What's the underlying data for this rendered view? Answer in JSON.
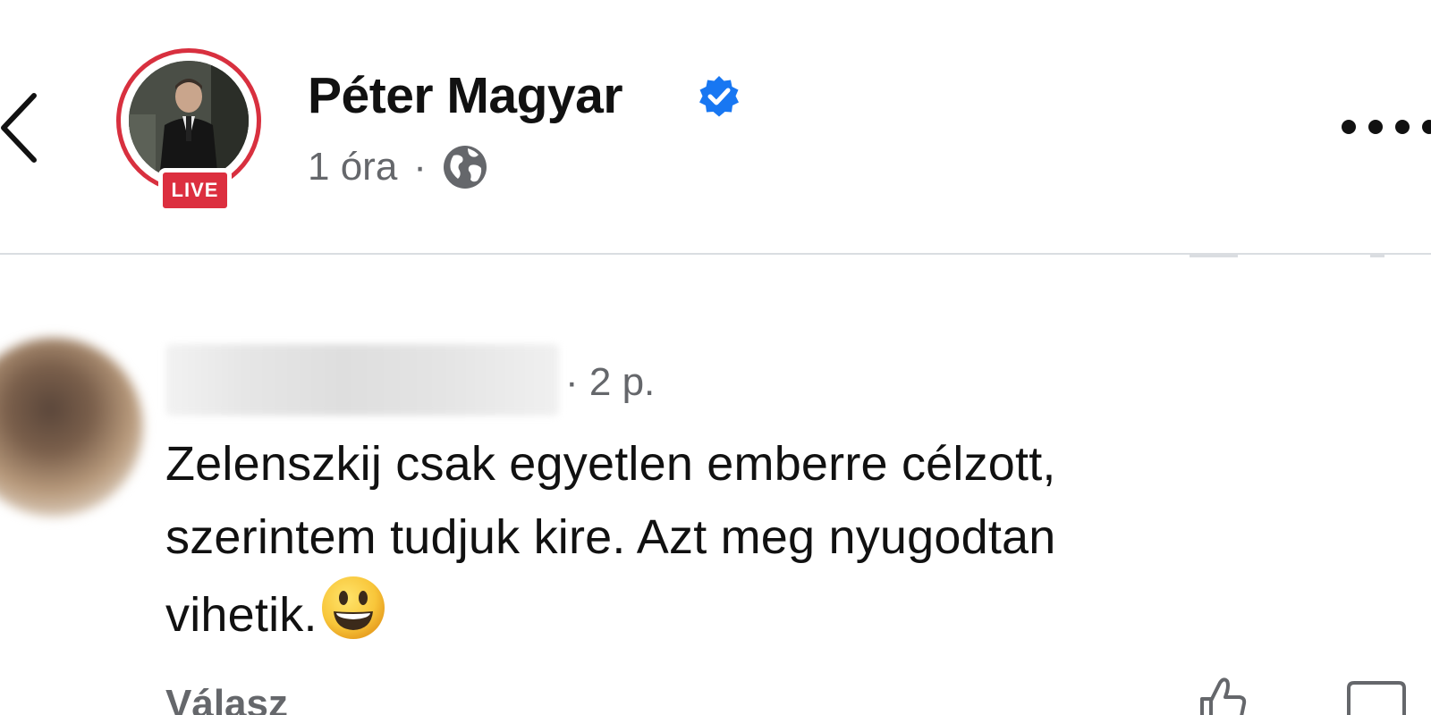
{
  "post": {
    "author_name": "Péter Magyar",
    "verified": true,
    "live_badge": "LIVE",
    "time": "1 óra",
    "separator": "·",
    "audience_icon": "globe-icon"
  },
  "header": {
    "back_icon": "chevron-left-icon",
    "more_icon": "more-horizontal-icon"
  },
  "comment": {
    "author_name_blurred": true,
    "time": "· 2 p.",
    "text_lines": [
      "Zelenszkij csak egyetlen emberre célzott,",
      "szerintem tudjuk kire. Azt meg nyugodtan",
      "vihetik."
    ],
    "emoji": "smiley-emoji",
    "reply_label": "Válasz",
    "like_icon": "like-icon",
    "comment_icon": "comment-icon"
  },
  "colors": {
    "live_red": "#dc2f3f",
    "verified_blue": "#1877f2",
    "meta_gray": "#65676b",
    "divider": "#dadde1"
  }
}
